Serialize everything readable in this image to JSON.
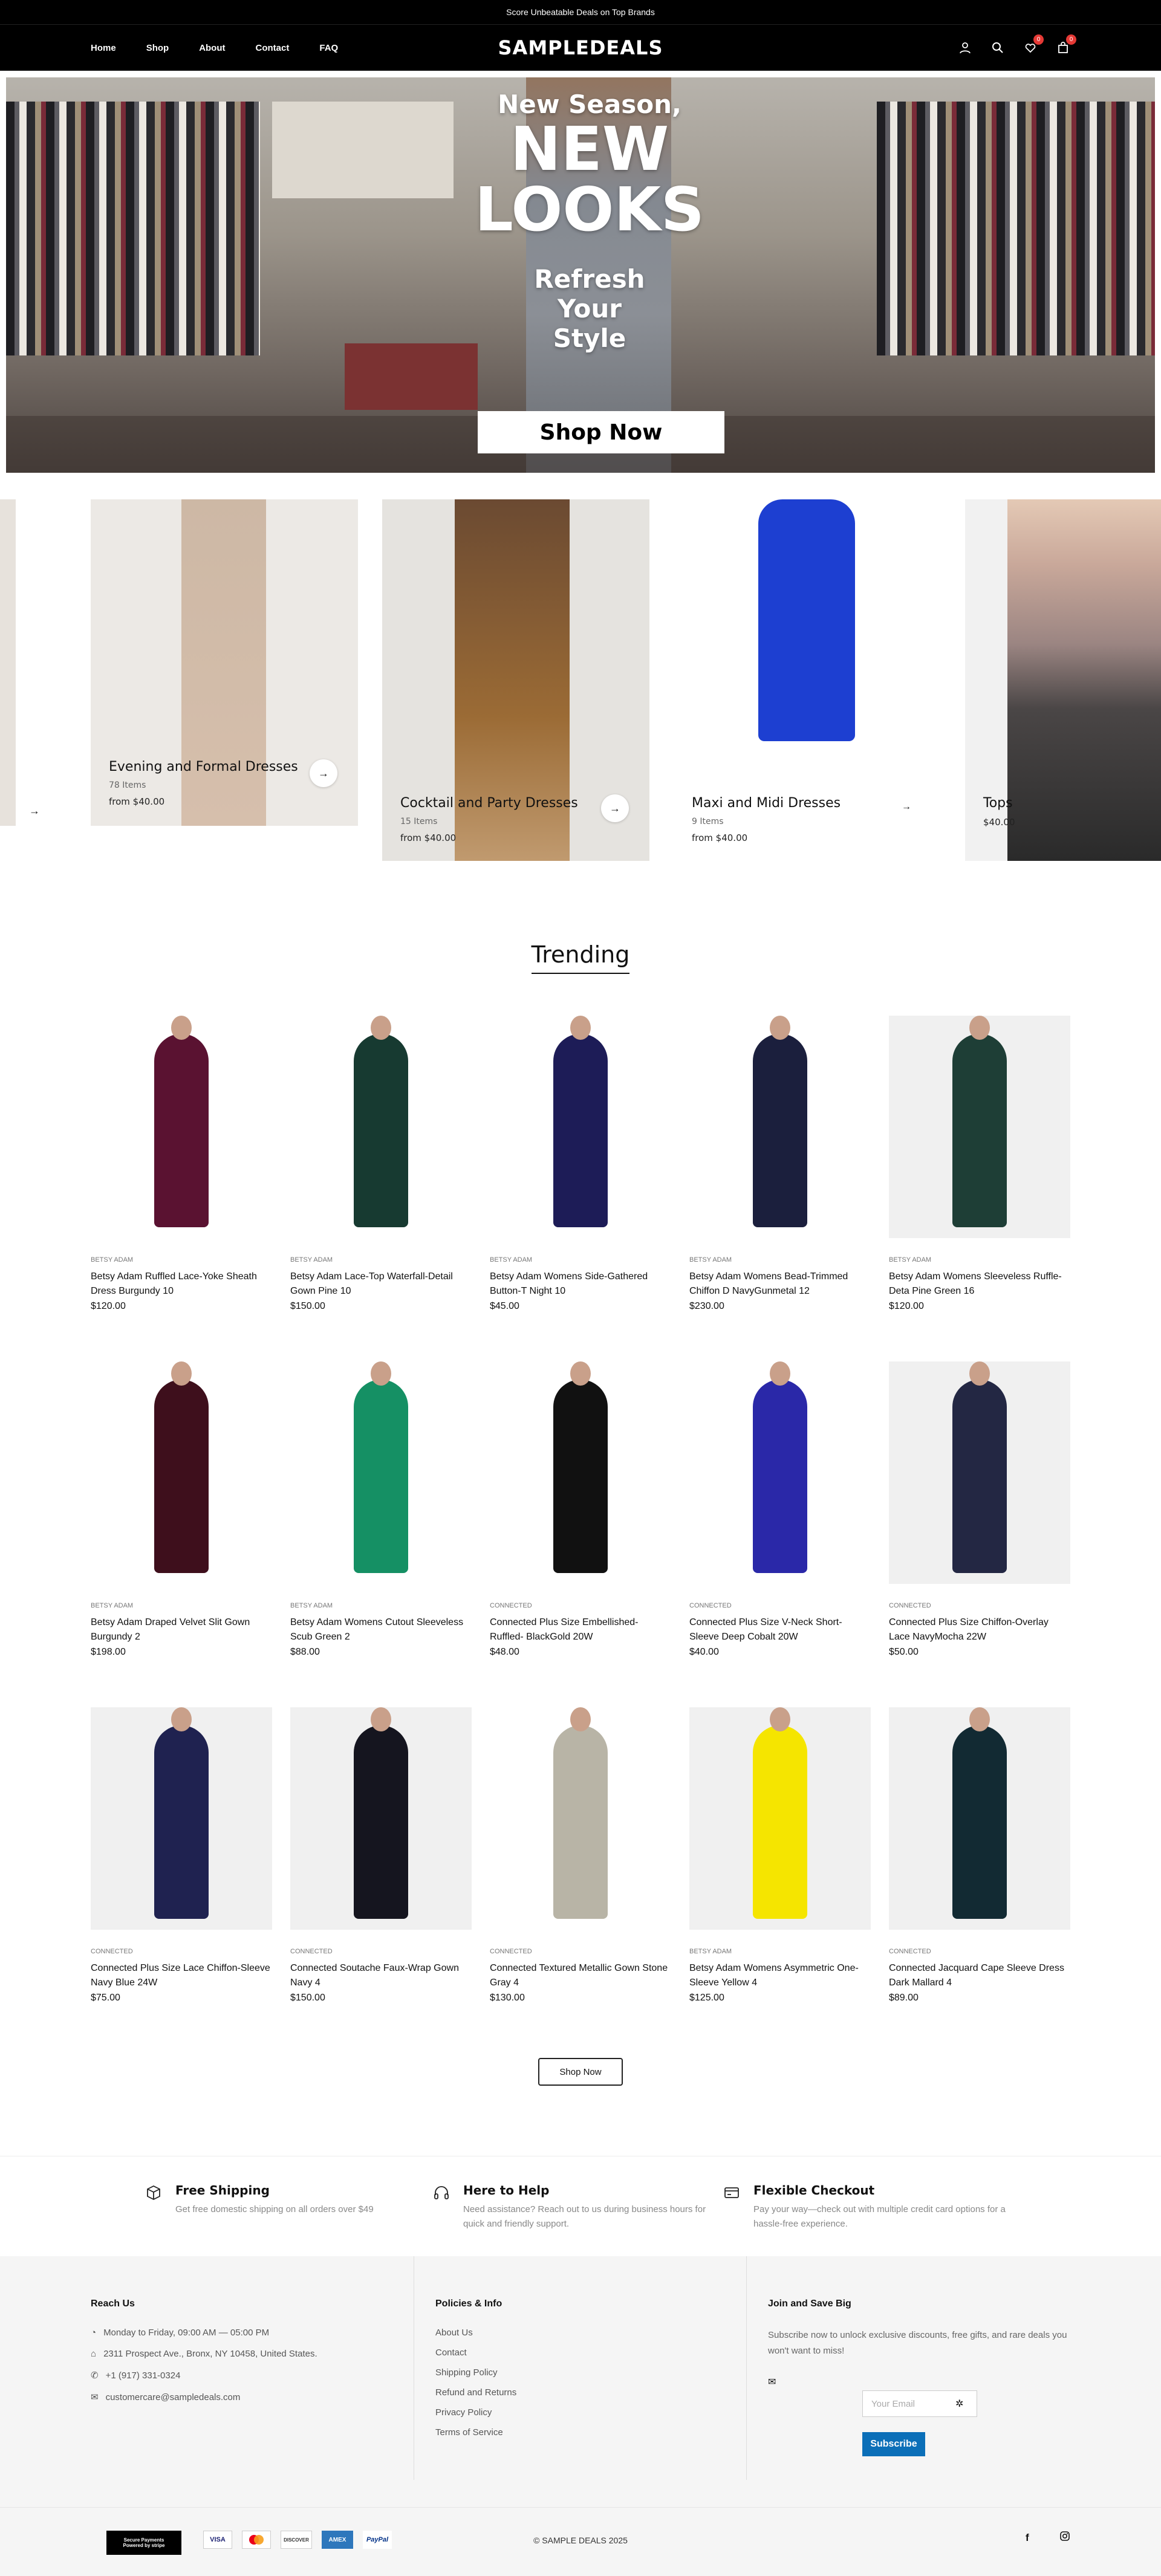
{
  "topbar": {
    "text": "Score Unbeatable Deals on Top Brands"
  },
  "header": {
    "nav": [
      "Home",
      "Shop",
      "About",
      "Contact",
      "FAQ"
    ],
    "logo": "SAMPLEDEALS",
    "wishlist_count": "0",
    "cart_count": "0",
    "icons": [
      "user-icon",
      "search-icon",
      "heart-icon",
      "bag-icon"
    ]
  },
  "hero": {
    "line1": "New Season,",
    "line2": "NEW",
    "line3": "LOOKS",
    "line4": "Refresh",
    "line5": "Your",
    "line6": "Style",
    "button": "Shop Now"
  },
  "categories": [
    {
      "name": "Evening and Formal Dresses",
      "count": "78 Items",
      "from": "from $40.00"
    },
    {
      "name": "Cocktail and Party Dresses",
      "count": "15 Items",
      "from": "from $40.00"
    },
    {
      "name": "Maxi and Midi Dresses",
      "count": "9 Items",
      "from": "from $40.00"
    },
    {
      "name": "Tops",
      "count": "",
      "from": "$40.00"
    }
  ],
  "trending": {
    "title": "Trending",
    "products": [
      {
        "brand": "BETSY ADAM",
        "name": "Betsy Adam Ruffled Lace-Yoke Sheath Dress Burgundy 10",
        "price": "$120.00",
        "color": "#5a1231"
      },
      {
        "brand": "BETSY ADAM",
        "name": "Betsy Adam Lace-Top Waterfall-Detail Gown Pine 10",
        "price": "$150.00",
        "color": "#173a31"
      },
      {
        "brand": "BETSY ADAM",
        "name": "Betsy Adam Womens Side-Gathered Button-T Night 10",
        "price": "$45.00",
        "color": "#1d1c57"
      },
      {
        "brand": "BETSY ADAM",
        "name": "Betsy Adam Womens Bead-Trimmed Chiffon D NavyGunmetal 12",
        "price": "$230.00",
        "color": "#1b1f3d"
      },
      {
        "brand": "BETSY ADAM",
        "name": "Betsy Adam Womens Sleeveless Ruffle-Deta Pine Green 16",
        "price": "$120.00",
        "color": "#1e3e36"
      },
      {
        "brand": "BETSY ADAM",
        "name": "Betsy Adam Draped Velvet Slit Gown Burgundy 2",
        "price": "$198.00",
        "color": "#3e0f1c"
      },
      {
        "brand": "BETSY ADAM",
        "name": "Betsy Adam Womens Cutout Sleeveless Scub Green 2",
        "price": "$88.00",
        "color": "#159064"
      },
      {
        "brand": "CONNECTED",
        "name": "Connected Plus Size Embellished-Ruffled- BlackGold 20W",
        "price": "$48.00",
        "color": "#111111"
      },
      {
        "brand": "CONNECTED",
        "name": "Connected Plus Size V-Neck Short-Sleeve Deep Cobalt 20W",
        "price": "$40.00",
        "color": "#2a28a8"
      },
      {
        "brand": "CONNECTED",
        "name": "Connected Plus Size Chiffon-Overlay Lace NavyMocha 22W",
        "price": "$50.00",
        "color": "#232743"
      },
      {
        "brand": "CONNECTED",
        "name": "Connected Plus Size Lace Chiffon-Sleeve Navy Blue 24W",
        "price": "$75.00",
        "color": "#1f2250"
      },
      {
        "brand": "CONNECTED",
        "name": "Connected Soutache Faux-Wrap Gown Navy 4",
        "price": "$150.00",
        "color": "#15151f"
      },
      {
        "brand": "CONNECTED",
        "name": "Connected Textured Metallic Gown Stone Gray 4",
        "price": "$130.00",
        "color": "#b8b4a6"
      },
      {
        "brand": "BETSY ADAM",
        "name": "Betsy Adam Womens Asymmetric One-Sleeve Yellow 4",
        "price": "$125.00",
        "color": "#f5e500"
      },
      {
        "brand": "CONNECTED",
        "name": "Connected Jacquard Cape Sleeve Dress Dark Mallard 4",
        "price": "$89.00",
        "color": "#122a33"
      }
    ],
    "button": "Shop Now"
  },
  "features": [
    {
      "title": "Free Shipping",
      "desc": "Get free domestic shipping on all orders over $49",
      "icon": "box-icon"
    },
    {
      "title": "Here to Help",
      "desc": "Need assistance? Reach out to us during business hours for quick and friendly support.",
      "icon": "headphones-icon"
    },
    {
      "title": "Flexible Checkout",
      "desc": "Pay your way—check out with multiple credit card options for a hassle-free experience.",
      "icon": "credit-card-icon"
    }
  ],
  "footer": {
    "reach": {
      "title": "Reach Us",
      "hours": "Monday to Friday, 09:00 AM — 05:00 PM",
      "address": "2311 Prospect Ave., Bronx, NY 10458, United States.",
      "phone": "+1 (917) 331-0324",
      "email": "customercare@sampledeals.com"
    },
    "policies": {
      "title": "Policies & Info",
      "links": [
        "About Us",
        "Contact",
        "Shipping Policy",
        "Refund and Returns",
        "Privacy Policy",
        "Terms of Service"
      ]
    },
    "newsletter": {
      "title": "Join and Save Big",
      "desc": "Subscribe now to unlock exclusive discounts, free gifts, and rare deals you won't want to miss!",
      "placeholder": "Your Email",
      "button": "Subscribe"
    },
    "copyright": "© SAMPLE DEALS 2025",
    "secure_line1": "Secure Payments",
    "secure_line2": "Powered by stripe",
    "payments": [
      "VISA",
      "mastercard",
      "DISCOVER",
      "AMEX",
      "PayPal"
    ]
  }
}
